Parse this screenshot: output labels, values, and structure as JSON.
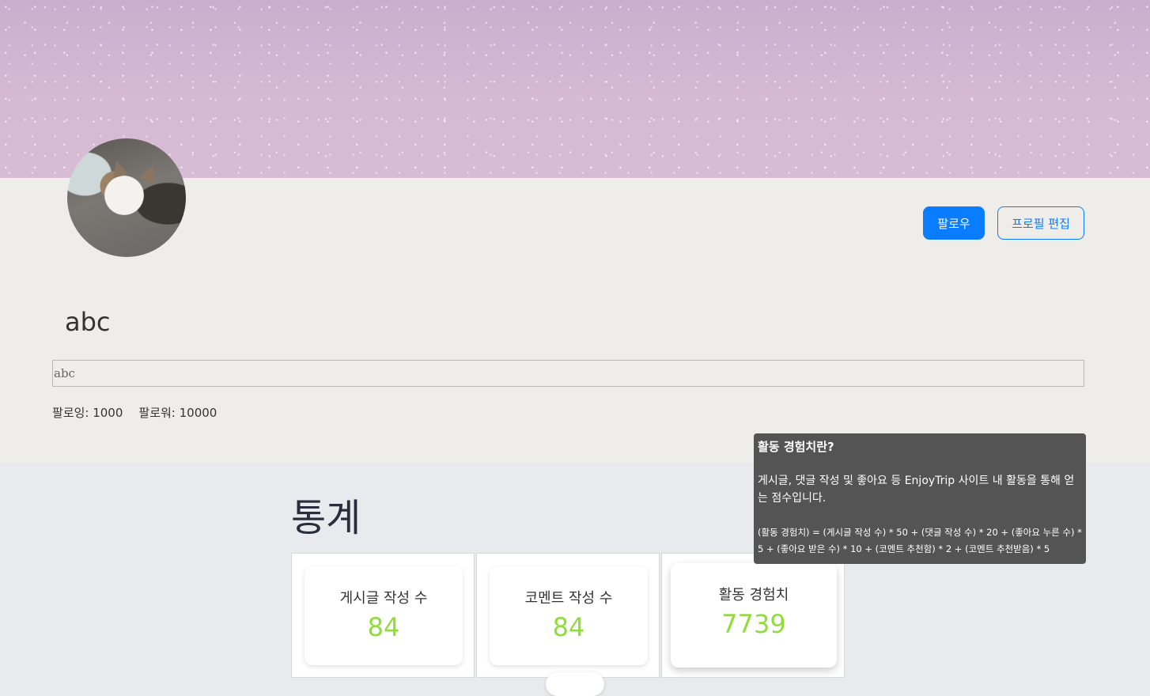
{
  "profile": {
    "username": "abc",
    "bio": "abc",
    "follow_button": "팔로우",
    "edit_button": "프로필 편집",
    "following_label": "팔로잉: 1000",
    "follower_label": "팔로워: 10000"
  },
  "stats": {
    "title": "통계",
    "cards": [
      {
        "label": "게시글 작성 수",
        "value": "84"
      },
      {
        "label": "코멘트 작성 수",
        "value": "84"
      },
      {
        "label": "활동 경험치",
        "value": "7739"
      }
    ],
    "value_color": "#8fdc3c"
  },
  "tooltip": {
    "title": "활동 경험치란?",
    "description": "게시글, 댓글 작성 및 좋아요 등 EnjoyTrip 사이트 내 활동을 통해 얻는 점수입니다.",
    "formula": "(활동 경험치) = (게시글 작성 수) * 50 + (댓글 작성 수) * 20 + (좋아요 누른 수) * 5 + (좋아요 받은 수) * 10 + (코멘트 추천함) * 2 + (코멘트 추천받음) * 5"
  },
  "colors": {
    "primary": "#0a7cff",
    "banner": "#d2b6d0",
    "profile_bg": "#efedea",
    "page_bg": "#e8eaed"
  }
}
